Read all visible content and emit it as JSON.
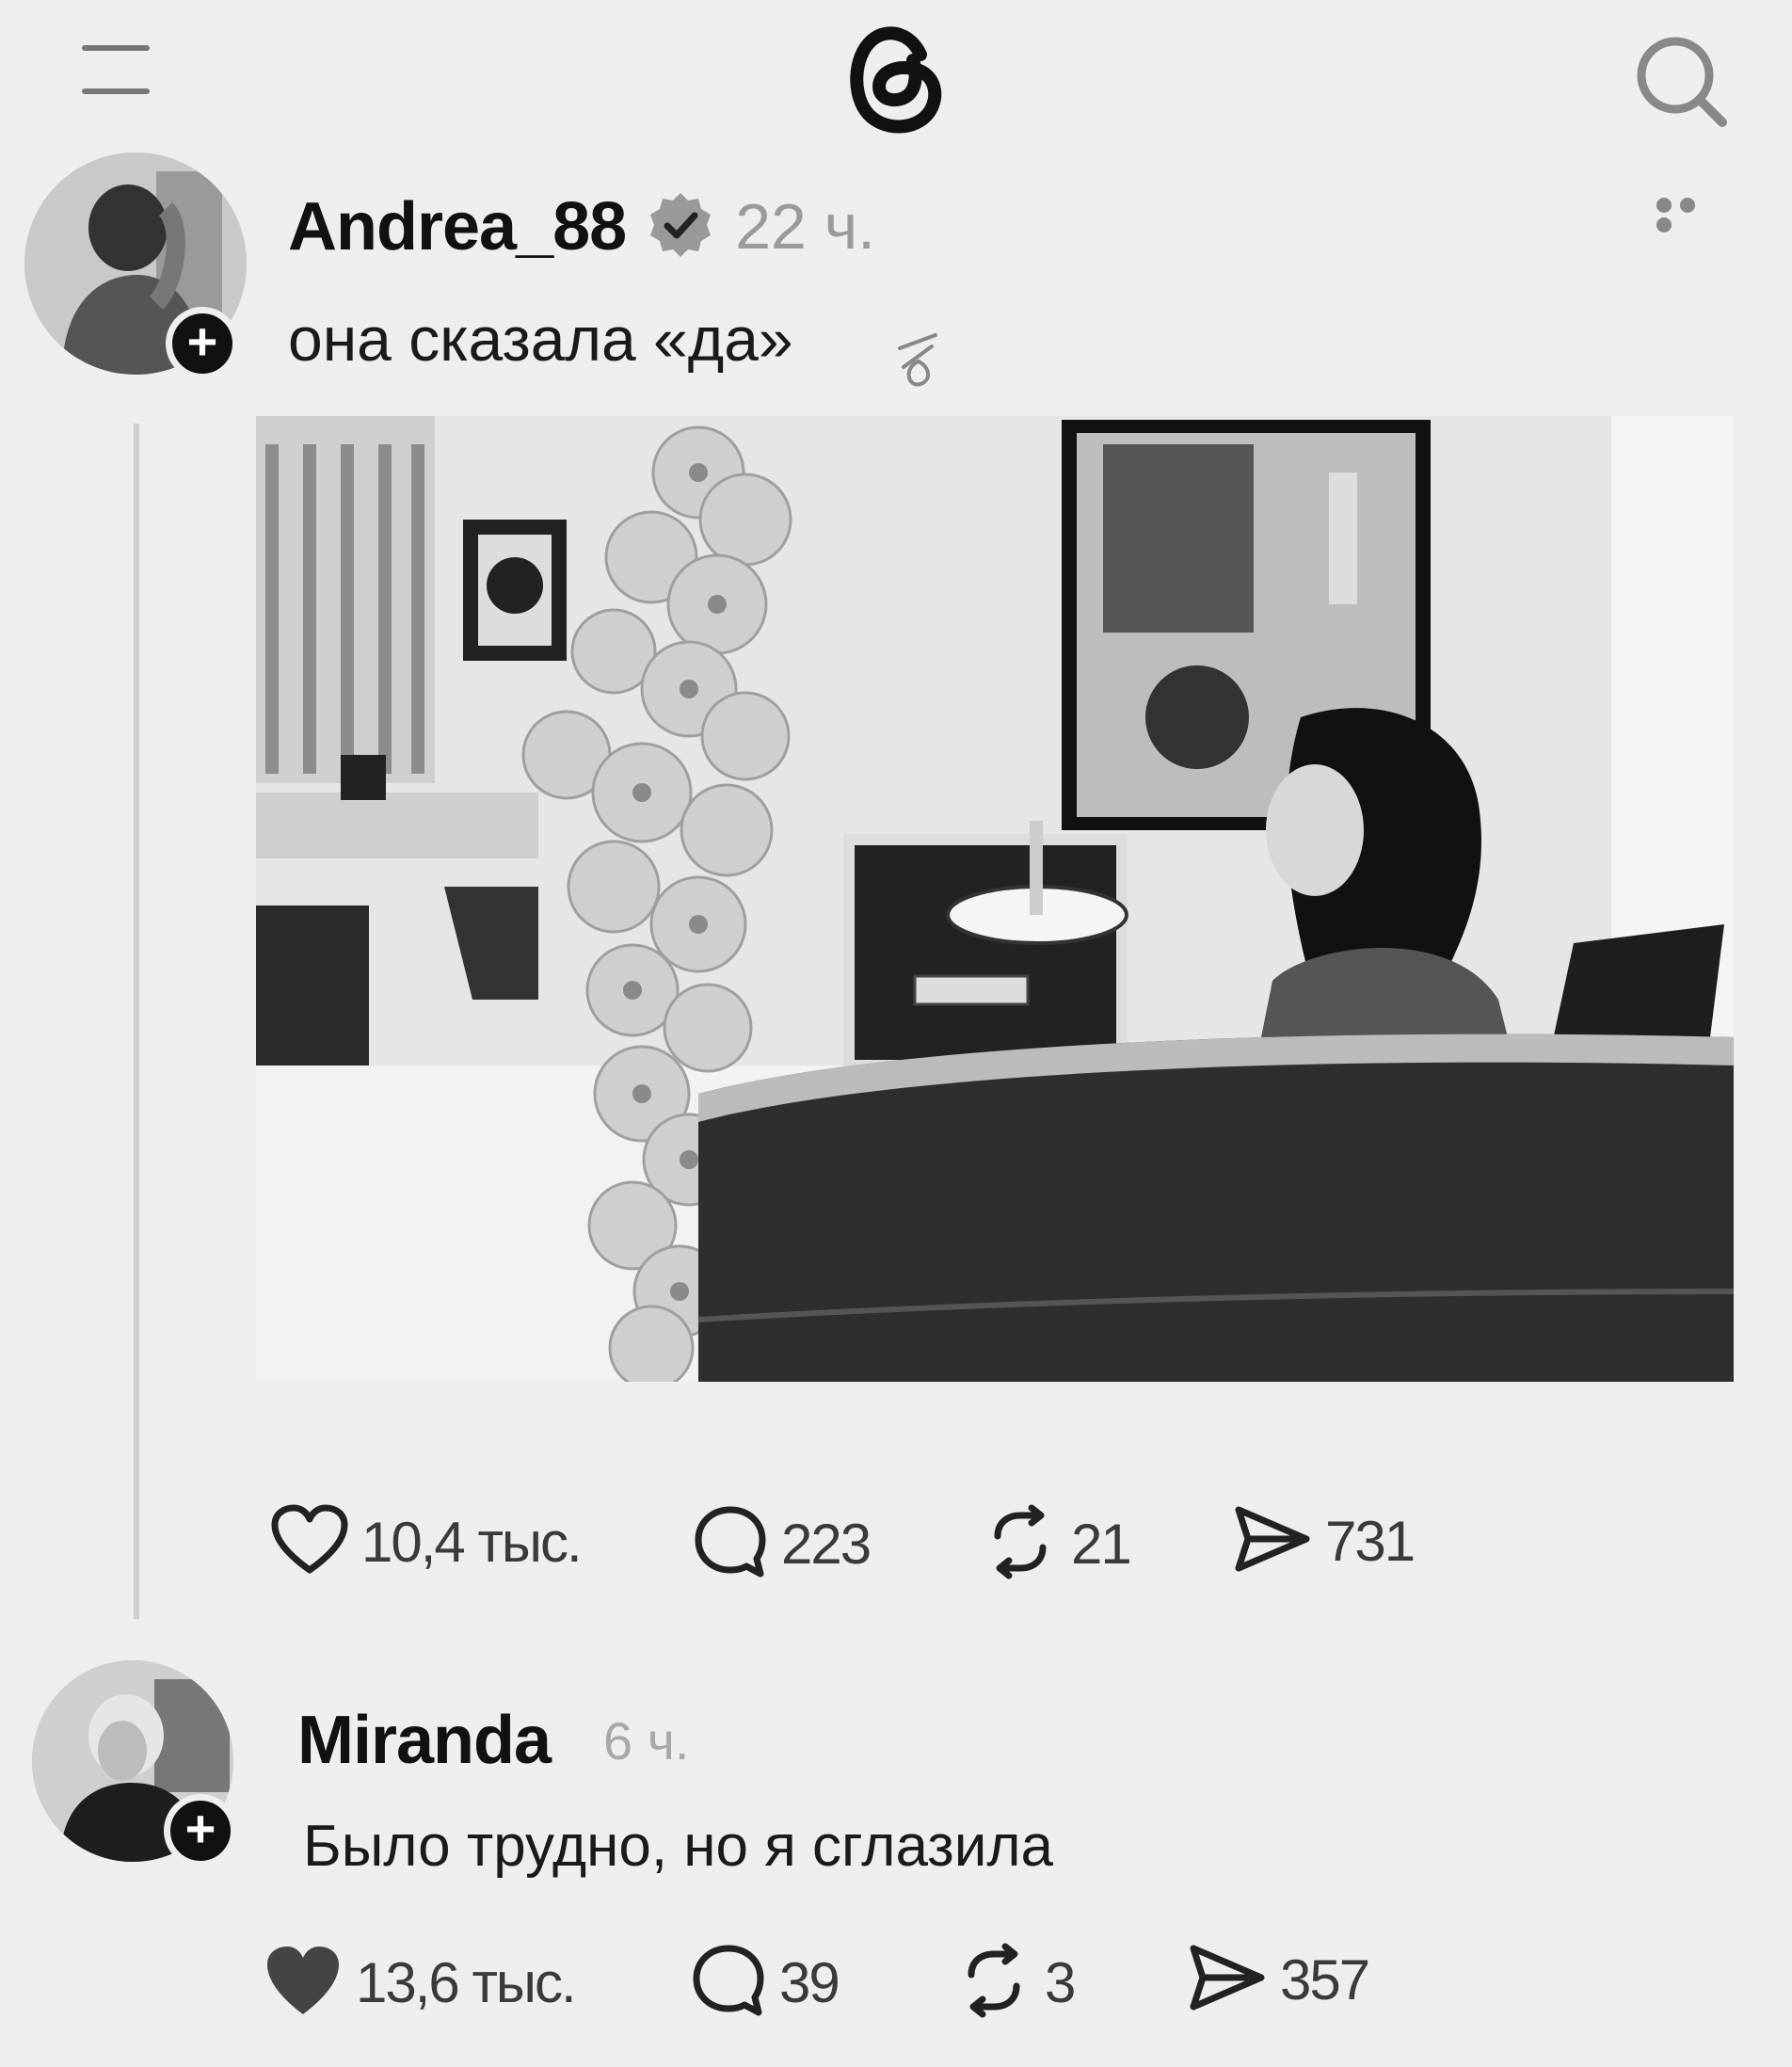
{
  "header": {
    "menu_icon": "menu-icon",
    "logo_icon": "threads-logo-icon",
    "search_icon": "search-icon"
  },
  "post": {
    "author": "Andrea_88",
    "verified": true,
    "time": "22 ч.",
    "text": "она сказала «да»",
    "stats": {
      "likes": "10,4 тыс.",
      "replies": "223",
      "reposts": "21",
      "shares": "731"
    }
  },
  "reply": {
    "author": "Miranda",
    "time": "6 ч.",
    "text": "Было трудно, но я сглазила",
    "liked": true,
    "stats": {
      "likes": "13,6 тыс.",
      "replies": "39",
      "reposts": "3",
      "shares": "357"
    }
  },
  "colors": {
    "background": "#eeeeee",
    "text": "#111111",
    "muted": "#9a9a9a"
  }
}
